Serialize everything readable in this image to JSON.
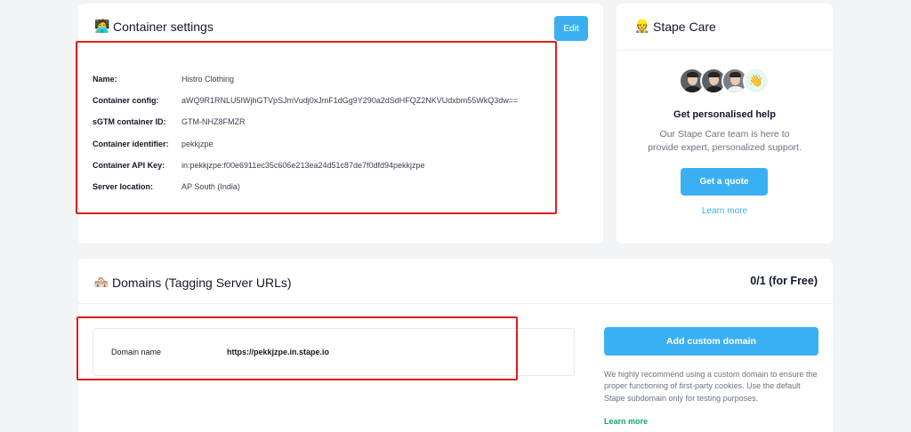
{
  "container_settings": {
    "emoji": "🧑‍💻",
    "title": "Container settings",
    "edit_label": "Edit",
    "rows": [
      {
        "label": "Name:",
        "value": "Histro Clothing"
      },
      {
        "label": "Container config:",
        "value": "aWQ9R1RNLU5IWjhGTVpSJmVudj0xJmF1dGg9Y290a2dSdHFQZ2NKVUdxbm55WkQ3dw=="
      },
      {
        "label": "sGTM container ID:",
        "value": "GTM-NHZ8FMZR"
      },
      {
        "label": "Container identifier:",
        "value": "pekkjzpe"
      },
      {
        "label": "Container API Key:",
        "value": "in:pekkjzpe:f00e6911ec35c606e213ea24d51c87de7f0dfd94pekkjzpe"
      },
      {
        "label": "Server location:",
        "value": "AP South (India)"
      }
    ]
  },
  "stape_care": {
    "emoji": "👷",
    "title": "Stape Care",
    "wave_emoji": "👋",
    "heading": "Get personalised help",
    "text": "Our Stape Care team is here to provide expert, personalized support.",
    "quote_label": "Get a quote",
    "learn_more": "Learn more"
  },
  "domains": {
    "emoji": "🏘️",
    "title": "Domains (Tagging Server URLs)",
    "plan_count": "0/1 (for Free)",
    "domain_label": "Domain name",
    "domain_value": "https://pekkjzpe.in.stape.io",
    "add_button": "Add custom domain",
    "recommend_text": "We highly recommend using a custom domain to ensure the proper functioning of first-party cookies. Use the default Stape subdomain only for testing purposes.",
    "learn_more": "Learn more"
  },
  "colors": {
    "accent": "#3ab0f3",
    "highlight": "#e11d1d",
    "link_green": "#15a66a"
  }
}
